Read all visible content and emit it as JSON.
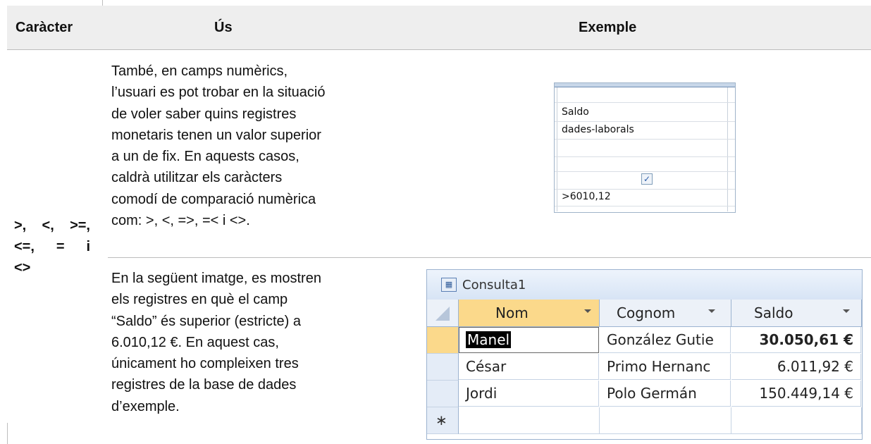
{
  "header": {
    "col1": "Caràcter",
    "col2": "Ús",
    "col3": "Exemple"
  },
  "character": {
    "lines": [
      ">, <, >=,",
      "<=,  =  i",
      "<>"
    ]
  },
  "row1": {
    "usage_lines": [
      "També, en camps numèrics,",
      "l’usuari es pot trobar en la situació",
      "de voler saber quins registres",
      "monetaris tenen un valor superior",
      "a un de fix. En aquests casos,",
      "caldrà utilitzar els caràcters",
      "comodí de comparació numèrica",
      "com: >, <, =>, =< i <>."
    ],
    "design_grid": {
      "field": "Saldo",
      "table": "dades-laborals",
      "show_checked": true,
      "criteria": ">6010,12"
    }
  },
  "row2": {
    "usage_lines": [
      "En la següent imatge, es mostren",
      "els registres en què el camp",
      "“Saldo” és superior (estricte) a",
      "6.010,12 €. En aquest cas,",
      "únicament ho compleixen tres",
      "registres de la base de dades",
      "d’exemple."
    ],
    "datasheet": {
      "title": "Consulta1",
      "columns": [
        "Nom",
        "Cognom",
        "Saldo"
      ],
      "rows": [
        {
          "nom": "Manel",
          "cognom": "González Gutie",
          "saldo": "30.050,61 €"
        },
        {
          "nom": "César",
          "cognom": "Primo Hernanc",
          "saldo": "6.011,92 €"
        },
        {
          "nom": "Jordi",
          "cognom": "Polo Germán",
          "saldo": "150.449,14 €"
        }
      ],
      "new_row_marker": "∗"
    }
  },
  "colors": {
    "header_bg": "#eeeeee",
    "rule": "#bdbdbd",
    "selected_header": "#fbd98b"
  }
}
